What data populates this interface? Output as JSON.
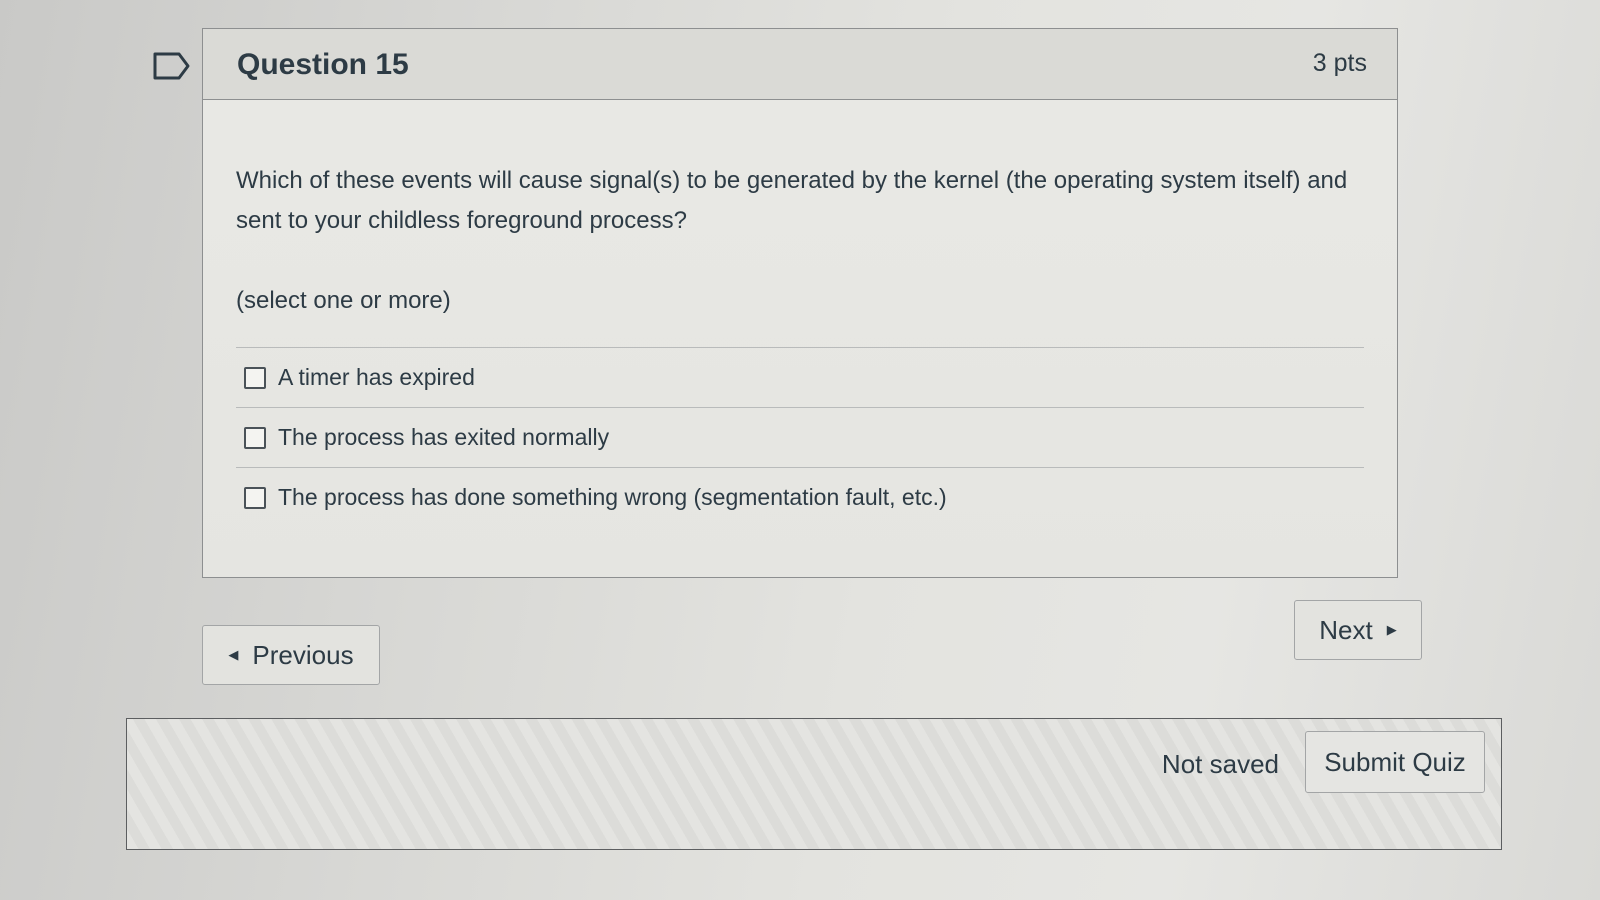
{
  "question": {
    "title": "Question 15",
    "points": "3 pts",
    "text": "Which of these events will cause signal(s) to be generated by the kernel (the operating system itself) and sent to your childless foreground process?",
    "hint": "(select one or more)",
    "answers": [
      {
        "label": "A timer has expired",
        "checked": false
      },
      {
        "label": "The process has exited normally",
        "checked": false
      },
      {
        "label": "The process has done something wrong (segmentation fault, etc.)",
        "checked": false
      }
    ]
  },
  "navigation": {
    "previous_label": "Previous",
    "next_label": "Next"
  },
  "footer": {
    "save_status": "Not saved",
    "submit_label": "Submit Quiz"
  },
  "icons": {
    "flag": "flag-outline-icon",
    "prev": "caret-left-icon",
    "next": "caret-right-icon"
  },
  "colors": {
    "text": "#2d3b45",
    "border": "#8d8f90"
  }
}
